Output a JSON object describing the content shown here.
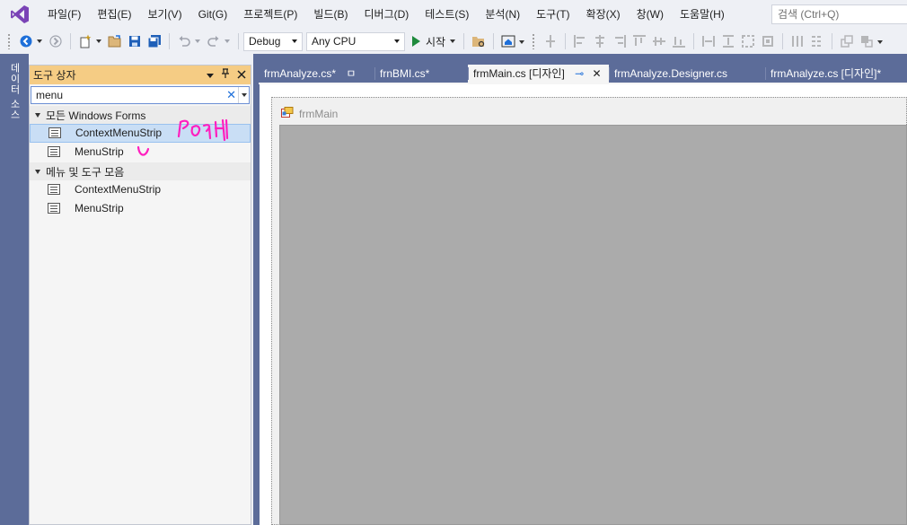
{
  "menubar": {
    "logo": "vs-logo-icon",
    "items": [
      "파일(F)",
      "편집(E)",
      "보기(V)",
      "Git(G)",
      "프로젝트(P)",
      "빌드(B)",
      "디버그(D)",
      "테스트(S)",
      "분석(N)",
      "도구(T)",
      "확장(X)",
      "창(W)",
      "도움말(H)"
    ],
    "search_placeholder": "검색 (Ctrl+Q)"
  },
  "toolbar": {
    "configuration": "Debug",
    "platform": "Any CPU",
    "start_label": "시작"
  },
  "dockstrip": {
    "tab_label": "데이터 소스"
  },
  "toolbox": {
    "title": "도구 상자",
    "search_value": "menu",
    "groups": [
      {
        "label": "모든 Windows Forms",
        "items": [
          "ContextMenuStrip",
          "MenuStrip"
        ]
      },
      {
        "label": "메뉴 및 도구 모음",
        "items": [
          "ContextMenuStrip",
          "MenuStrip"
        ]
      }
    ],
    "annotation": "handwritten pink scribble (Popup + check mark)"
  },
  "tabs": [
    {
      "label": "frmAnalyze.cs*",
      "pin": "ㅁ",
      "active": false
    },
    {
      "label": "frnBMI.cs*",
      "active": false
    },
    {
      "label": "frmMain.cs [디자인]",
      "active": true
    },
    {
      "label": "frmAnalyze.Designer.cs",
      "active": false
    },
    {
      "label": "frmAnalyze.cs [디자인]*",
      "active": false
    }
  ],
  "designer": {
    "form_title": "frmMain"
  },
  "colors": {
    "accent_dock": "#5c6c99",
    "toolbox_header": "#f5cc84",
    "selected_item": "#c9def5",
    "annotation": "#ff1fbf"
  }
}
